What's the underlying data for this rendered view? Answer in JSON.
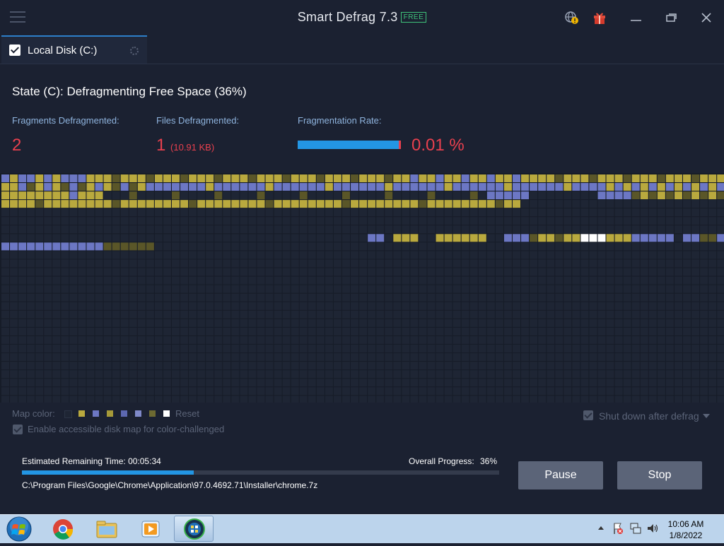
{
  "titlebar": {
    "app_title": "Smart Defrag 7.3",
    "badge": "FREE"
  },
  "tab": {
    "label": "Local Disk (C:)"
  },
  "state": {
    "text": "State (C): Defragmenting Free Space (36%)"
  },
  "stats": {
    "fragments_label": "Fragments Defragmented:",
    "fragments_value": "2",
    "files_label": "Files Defragmented:",
    "files_value": "1",
    "files_size": "(10.91 KB)",
    "rate_label": "Fragmentation Rate:",
    "rate_value": "0.01 %"
  },
  "map_legend": {
    "label": "Map color:",
    "reset": "Reset",
    "accessible_label": "Enable accessible disk map for color-challenged",
    "shutdown_label": "Shut down after defrag",
    "swatch_colors": [
      "#1e2534",
      "#b9a93e",
      "#6c77c4",
      "#a69a39",
      "#5d68b0",
      "#7f89c9",
      "#6d6a32",
      "#ffffff"
    ]
  },
  "progress": {
    "est_label": "Estimated Remaining Time:",
    "est_value": "00:05:34",
    "overall_label": "Overall Progress:",
    "overall_value": "36%",
    "overall_fraction": 0.36,
    "current_file": "C:\\Program Files\\Google\\Chrome\\Application\\97.0.4692.71\\Installer\\chrome.7z"
  },
  "buttons": {
    "pause": "Pause",
    "stop": "Stop"
  },
  "taskbar": {
    "time": "10:06 AM",
    "date": "1/8/2022"
  },
  "colors": {
    "accent": "#2396e4",
    "value_red": "#e8404e",
    "block_empty": "#1e2534",
    "block_gold": "#b9a93e",
    "block_gold_dark": "#5a5628",
    "block_blue": "#6c77c4",
    "block_white": "#ffffff"
  }
}
